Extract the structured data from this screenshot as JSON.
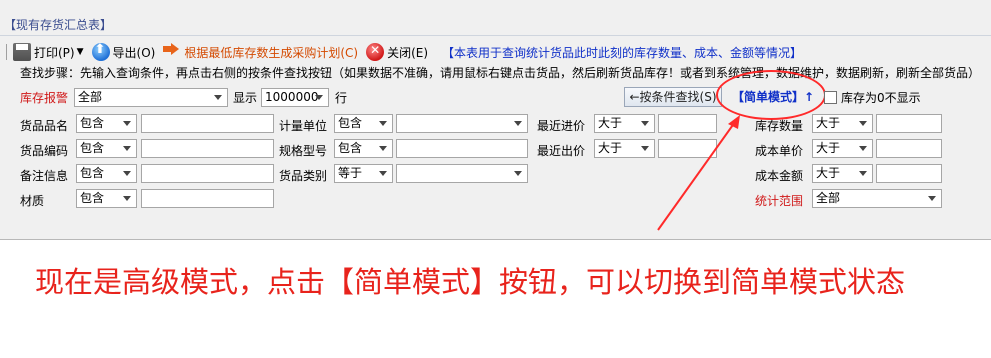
{
  "window": {
    "title": "【现有存货汇总表】"
  },
  "toolbar": {
    "print_label": "打印(P)",
    "export_label": "导出(O)",
    "generate_label": "根据最低库存数生成采购计划(C)",
    "close_label": "关闭(E)",
    "note": "【本表用于查询统计货品此时此刻的库存数量、成本、金额等情况】"
  },
  "steps": "查找步骤：先输入查询条件，再点击右侧的按条件查找按钮（如果数据不准确，请用鼠标右键点击货品，然后刷新货品库存！或者到系统管理，数据维护，数据刷新，刷新全部货品）",
  "row1": {
    "stock_alert_label": "库存报警",
    "stock_alert_value": "全部",
    "show_label": "显示",
    "show_value": "1000000",
    "rows_label": "行",
    "search_button": "←按条件查找(S)",
    "simple_mode_button": "【简单模式】↑",
    "zero_stock_label": "库存为0不显示"
  },
  "filters": {
    "col1": [
      {
        "label": "货品品名",
        "op": "包含",
        "value": ""
      },
      {
        "label": "货品编码",
        "op": "包含",
        "value": ""
      },
      {
        "label": "备注信息",
        "op": "包含",
        "value": ""
      },
      {
        "label": "材质",
        "op": "包含",
        "value": ""
      }
    ],
    "col2": [
      {
        "label": "计量单位",
        "op": "包含",
        "value": ""
      },
      {
        "label": "规格型号",
        "op": "包含",
        "value": ""
      },
      {
        "label": "货品类别",
        "op": "等于",
        "value": ""
      }
    ],
    "col3": [
      {
        "label": "最近进价",
        "op": "大于",
        "value": ""
      },
      {
        "label": "最近出价",
        "op": "大于",
        "value": ""
      }
    ],
    "col4": [
      {
        "label": "库存数量",
        "op": "大于",
        "value": ""
      },
      {
        "label": "成本单价",
        "op": "大于",
        "value": ""
      },
      {
        "label": "成本金额",
        "op": "大于",
        "value": ""
      }
    ],
    "range_label": "统计范围",
    "range_value": "全部"
  },
  "annotation": "现在是高级模式，点击【简单模式】按钮，可以切换到简单模式状态",
  "colors": {
    "annotation": "#e8231c",
    "highlight": "#ff2a2a",
    "link_blue": "#1030c8"
  }
}
